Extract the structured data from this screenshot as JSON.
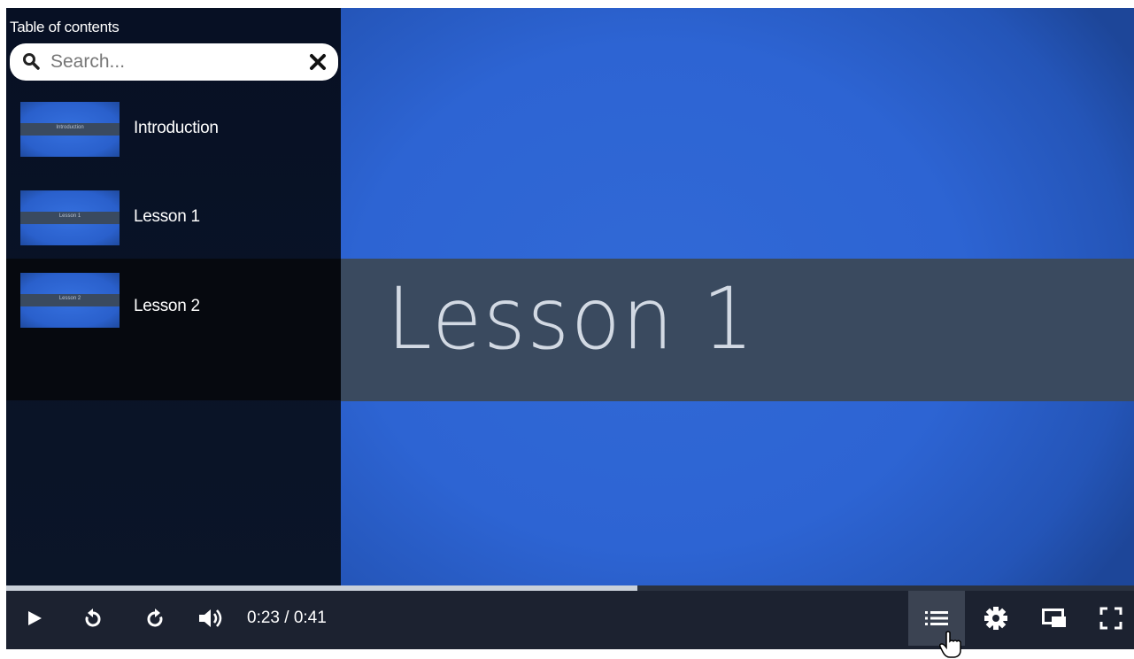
{
  "sidebar": {
    "title": "Table of contents",
    "search_placeholder": "Search...",
    "items": [
      {
        "label": "Introduction",
        "thumb_text": "Introduction",
        "active": false
      },
      {
        "label": "Lesson 1",
        "thumb_text": "Lesson 1",
        "active": false
      },
      {
        "label": "Lesson 2",
        "thumb_text": "Lesson 2",
        "active": true
      }
    ]
  },
  "video": {
    "slide_title": "Lesson 1",
    "colors": {
      "slide_bg": "#2d64d3",
      "band": "#3a4a5f"
    }
  },
  "controls": {
    "time": "0:23 / 0:41",
    "progress": 0.56,
    "icons": [
      "play-icon",
      "rewind-icon",
      "forward-icon",
      "volume-icon",
      "toc-list-icon",
      "settings-gear-icon",
      "picture-in-picture-icon",
      "fullscreen-icon"
    ]
  }
}
